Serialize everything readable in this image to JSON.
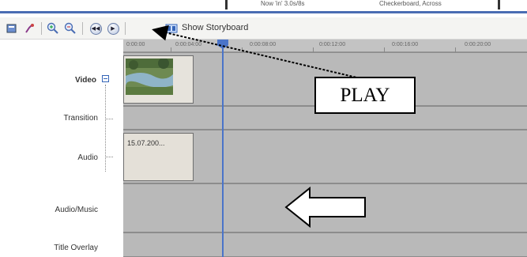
{
  "top_tabs": [
    "Now 'in' 3.0s/8s",
    "Checkerboard, Across"
  ],
  "toolbar": {
    "show_storyboard_label": "Show Storyboard"
  },
  "ruler_labels": [
    "0:00:00",
    "0:00:04:00",
    "0:00:08:00",
    "0:00:12:00",
    "0:00:16:00",
    "0:00:20:00"
  ],
  "tracks": {
    "video": "Video",
    "transition": "Transition",
    "audio": "Audio",
    "audio_music": "Audio/Music",
    "title_overlay": "Title Overlay"
  },
  "audio_clip_label": "15.07.200...",
  "annotation": {
    "play_label": "PLAY"
  },
  "colors": {
    "playhead": "#4a74c9",
    "lane": "#b9b9b9",
    "toolbar_bg": "#f4f4f2"
  }
}
